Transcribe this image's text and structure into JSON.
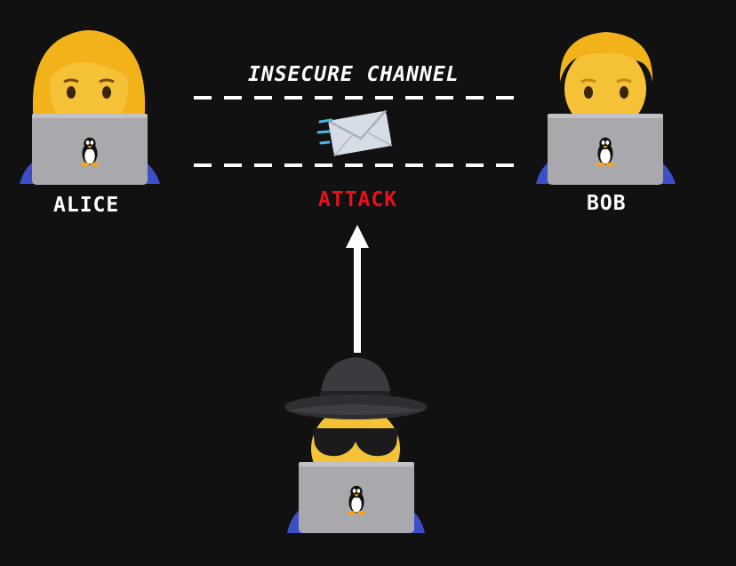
{
  "diagram": {
    "channel_title": "INSECURE CHANNEL",
    "attack_label": "ATTACK",
    "alice_label": "ALICE",
    "bob_label": "BOB"
  },
  "colors": {
    "background": "#111112",
    "text": "#ffffff",
    "attack": "#e8101a",
    "laptop": "#a9a9ad",
    "skin": "#f5c237",
    "hair_blond": "#f2b21a",
    "shirt": "#3d4fc7",
    "hat": "#3b3b3f"
  },
  "icons": {
    "alice": "woman-technologist-icon",
    "bob": "man-technologist-icon",
    "attacker": "spy-technologist-icon",
    "message": "envelope-icon",
    "laptop_logo": "linux-penguin-icon"
  }
}
